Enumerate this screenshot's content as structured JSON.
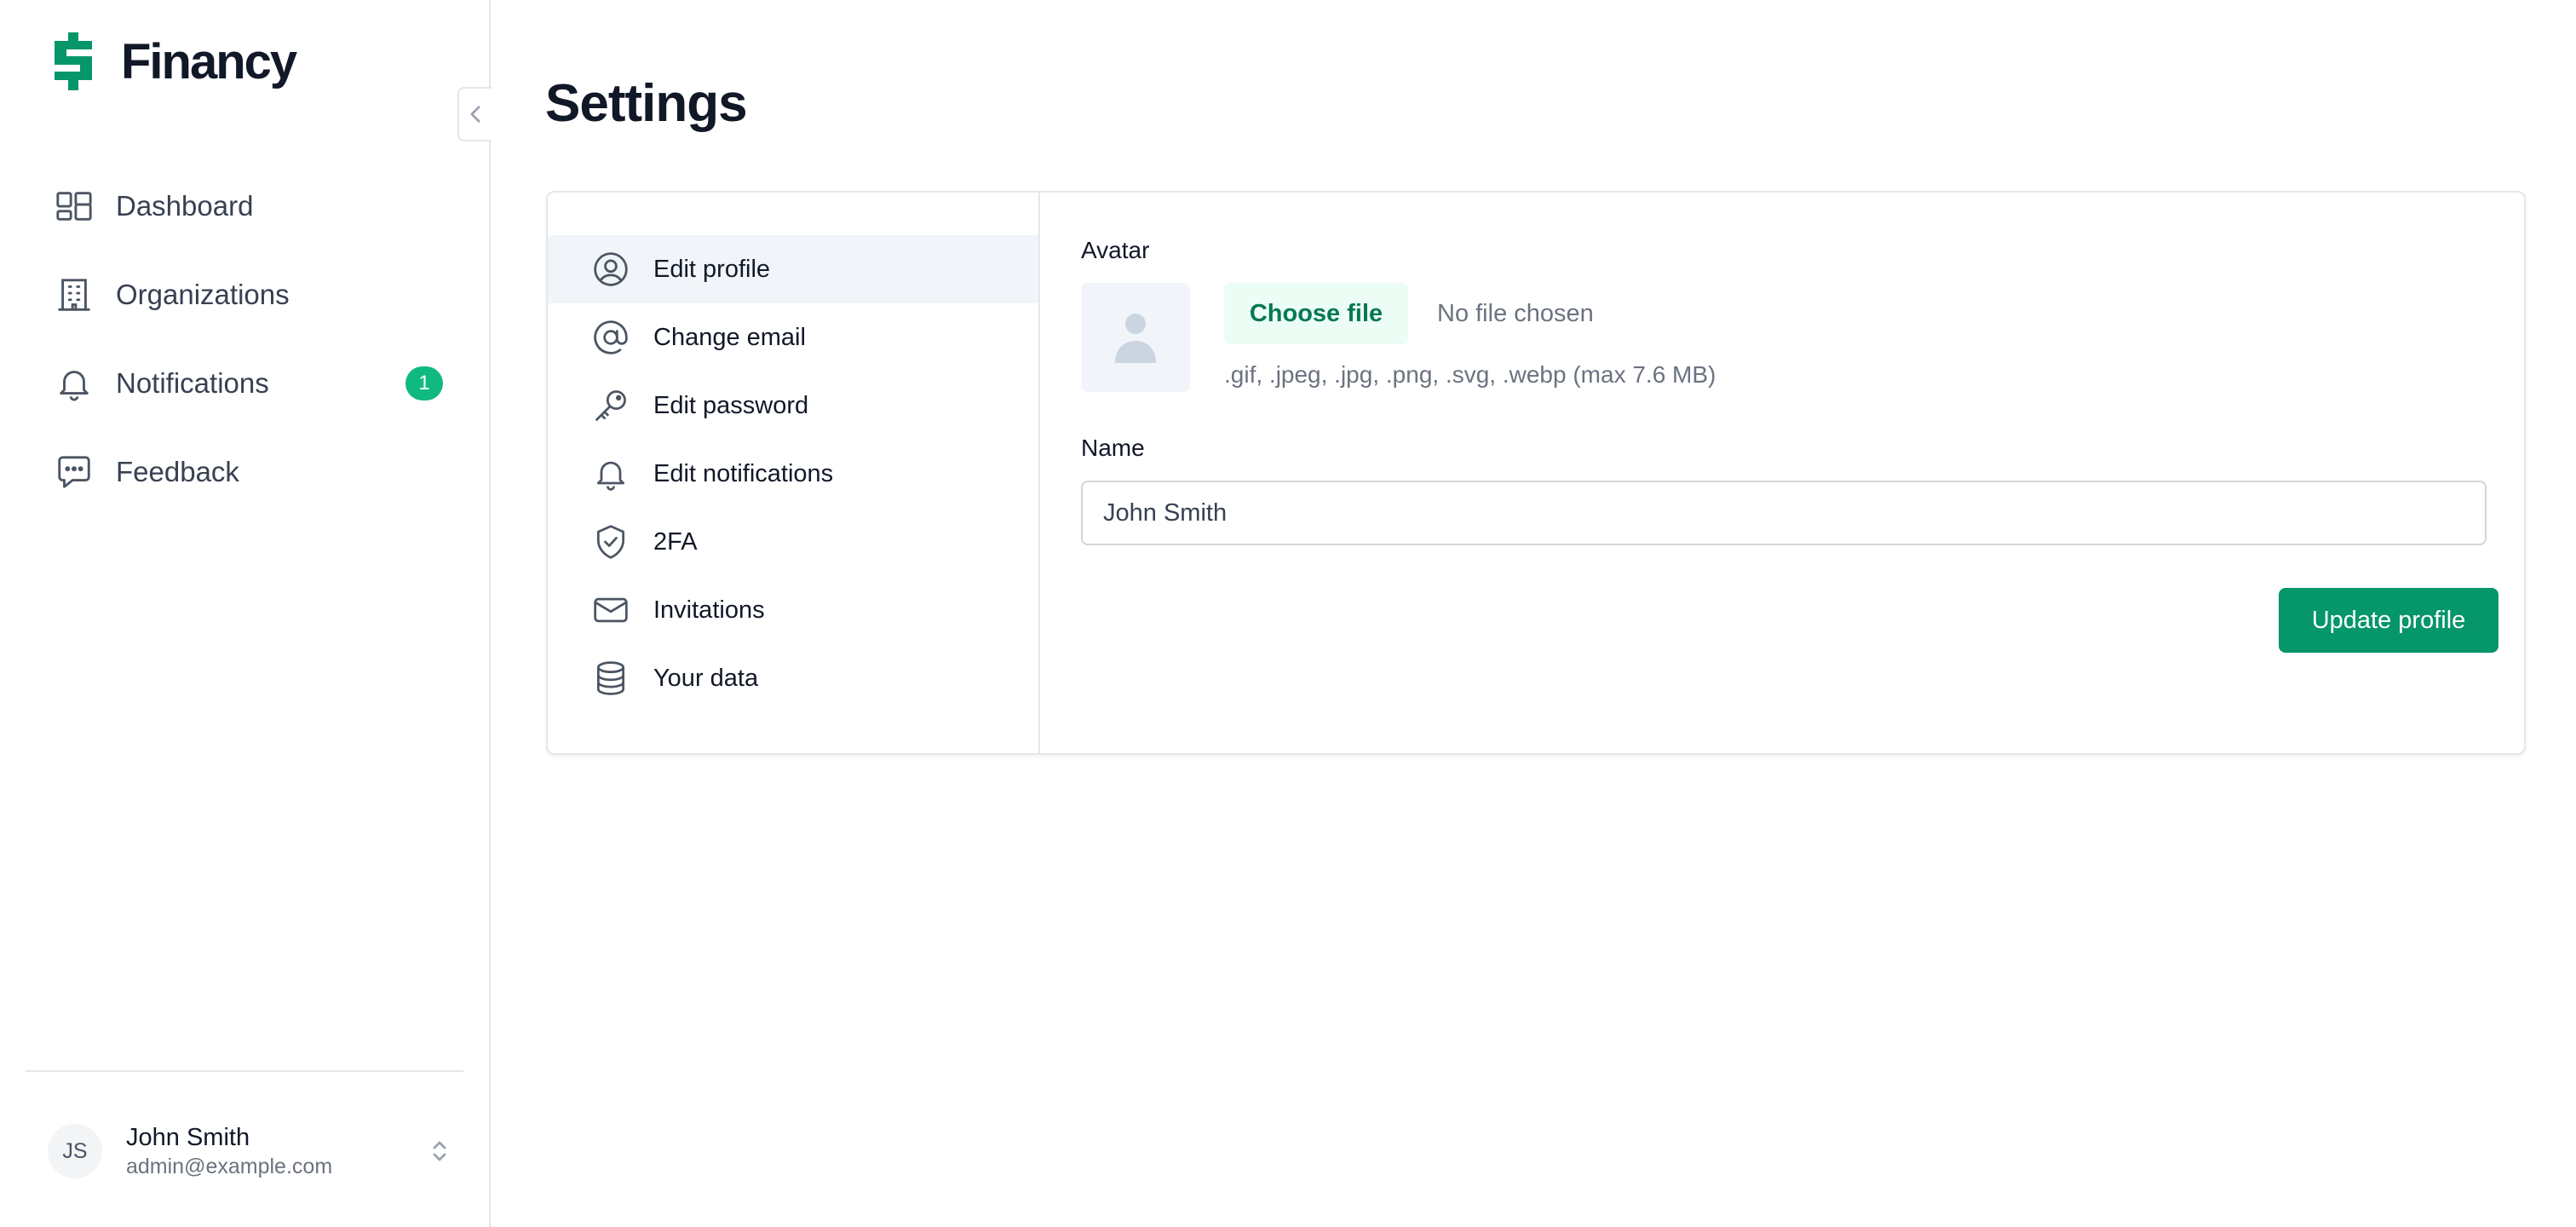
{
  "app": {
    "brand": "Financy",
    "brand_color": "#059669"
  },
  "sidebar": {
    "items": [
      {
        "label": "Dashboard",
        "icon": "dashboard-icon"
      },
      {
        "label": "Organizations",
        "icon": "building-icon"
      },
      {
        "label": "Notifications",
        "icon": "bell-icon",
        "badge": "1"
      },
      {
        "label": "Feedback",
        "icon": "chat-bubble-icon"
      }
    ],
    "user": {
      "initials": "JS",
      "name": "John Smith",
      "email": "admin@example.com"
    }
  },
  "page": {
    "title": "Settings"
  },
  "settings_menu": [
    {
      "label": "Edit profile",
      "icon": "user-circle-icon",
      "active": true
    },
    {
      "label": "Change email",
      "icon": "at-sign-icon"
    },
    {
      "label": "Edit password",
      "icon": "key-icon"
    },
    {
      "label": "Edit notifications",
      "icon": "bell-icon"
    },
    {
      "label": "2FA",
      "icon": "shield-check-icon"
    },
    {
      "label": "Invitations",
      "icon": "envelope-icon"
    },
    {
      "label": "Your data",
      "icon": "database-icon"
    }
  ],
  "profile_form": {
    "avatar_label": "Avatar",
    "choose_file_label": "Choose file",
    "no_file_text": "No file chosen",
    "file_hint": ".gif, .jpeg, .jpg, .png, .svg, .webp (max 7.6 MB)",
    "name_label": "Name",
    "name_value": "John Smith",
    "submit_label": "Update profile"
  }
}
